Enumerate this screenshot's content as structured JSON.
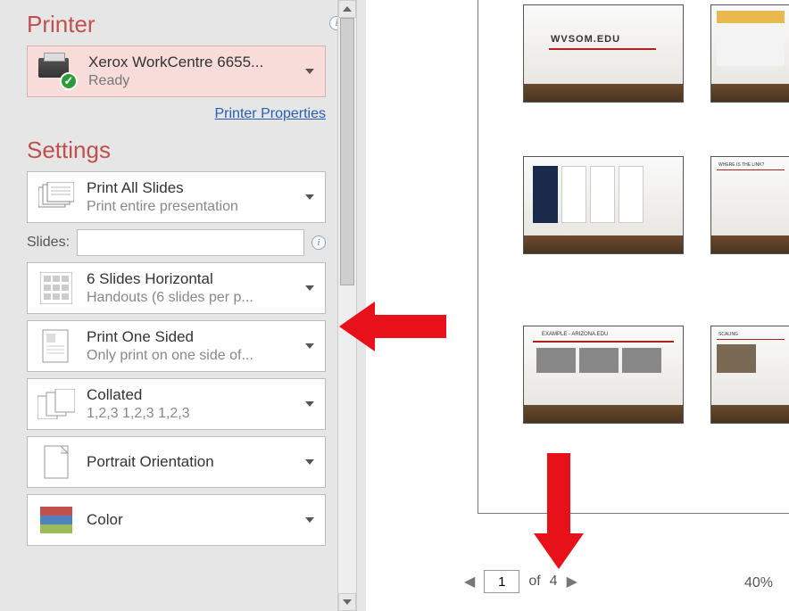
{
  "printer": {
    "heading": "Printer",
    "name": "Xerox WorkCentre 6655...",
    "status": "Ready",
    "properties_link": "Printer Properties"
  },
  "settings": {
    "heading": "Settings",
    "print_what": {
      "title": "Print All Slides",
      "sub": "Print entire presentation"
    },
    "slides_label": "Slides:",
    "slides_value": "",
    "layout": {
      "title": "6 Slides Horizontal",
      "sub": "Handouts (6 slides per p..."
    },
    "sides": {
      "title": "Print One Sided",
      "sub": "Only print on one side of..."
    },
    "collated": {
      "title": "Collated",
      "sub": "1,2,3   1,2,3   1,2,3"
    },
    "orientation": {
      "title": "Portrait Orientation",
      "sub": ""
    },
    "color": {
      "title": "Color",
      "sub": ""
    }
  },
  "pager": {
    "current": "1",
    "of_label": "of",
    "total": "4"
  },
  "zoom": {
    "value": "40%"
  },
  "preview_thumbnails": [
    {
      "label": "WVSOM.EDU"
    },
    {
      "label": ""
    },
    {
      "label": ""
    },
    {
      "label": "WHERE IS THE LINK?"
    },
    {
      "label": "EXAMPLE - ARIZONA.EDU"
    },
    {
      "label": "SCALING"
    }
  ]
}
